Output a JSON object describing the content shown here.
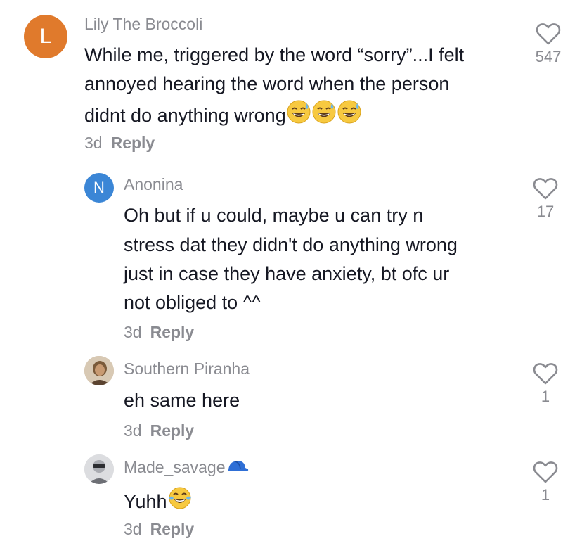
{
  "comments": [
    {
      "username": "Lily The Broccoli",
      "avatar_letter": "L",
      "avatar_color": "#e07a2c",
      "lines": [
        "While me, triggered by the word “sorry”...I felt",
        "annoyed hearing the word when the person",
        "didnt do anything wrong"
      ],
      "time": "3d",
      "reply": "Reply",
      "likes": "547"
    },
    {
      "username": "Anonina",
      "avatar_letter": "N",
      "avatar_color": "#3b86d6",
      "lines": [
        "Oh but if u could, maybe u can try n",
        "stress dat they didn't do anything wrong",
        "just in case they have anxiety, bt ofc ur",
        "not obliged to ^^"
      ],
      "time": "3d",
      "reply": "Reply",
      "likes": "17"
    },
    {
      "username": "Southern Piranha",
      "lines": [
        "eh same here"
      ],
      "time": "3d",
      "reply": "Reply",
      "likes": "1"
    },
    {
      "username": "Made_savage",
      "lines": [
        "Yuhh"
      ],
      "time": "3d",
      "reply": "Reply",
      "likes": "1"
    }
  ],
  "colors": {
    "text": "#161823",
    "muted": "#8a8b91",
    "heart_stroke": "#8a8b91"
  }
}
